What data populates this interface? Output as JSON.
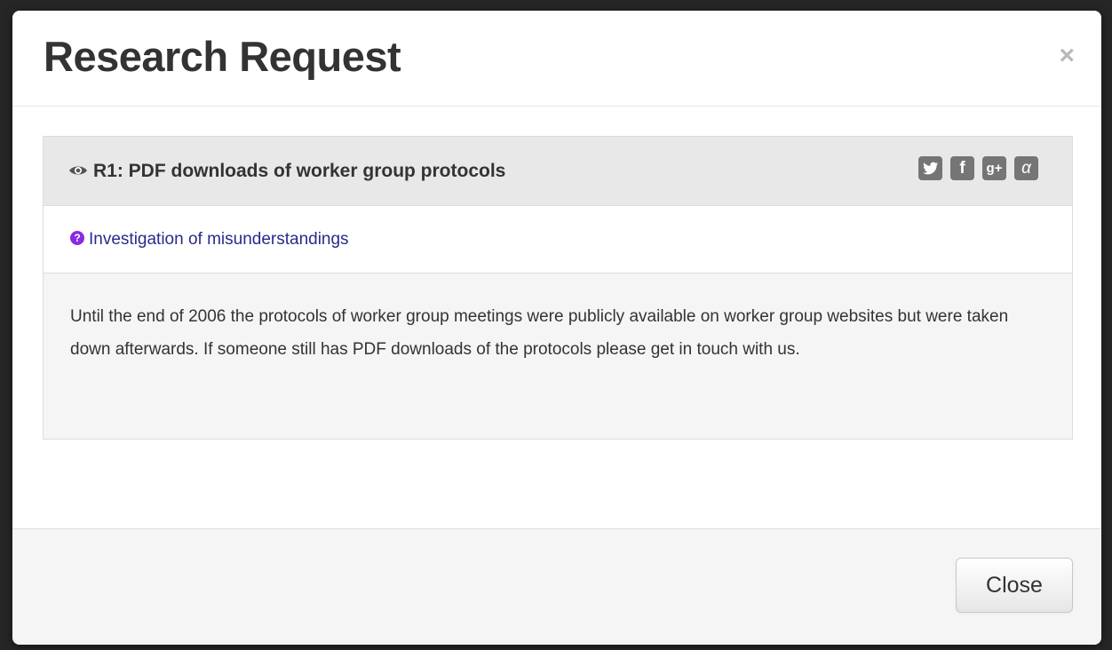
{
  "modal": {
    "title": "Research Request",
    "close_icon": "×",
    "close_button_label": "Close"
  },
  "request": {
    "title": "R1: PDF downloads of worker group protocols",
    "title_icon": "eye-icon",
    "category": "Investigation of misunderstandings",
    "category_icon": "question-circle-icon",
    "description": "Until the end of 2006 the protocols of worker group meetings were publicly available on worker group websites but were taken down afterwards. If someone still has PDF downloads of the protocols please get in touch with us."
  },
  "share": {
    "twitter_glyph": "t",
    "facebook_glyph": "f",
    "googleplus_glyph": "g+",
    "email_glyph": "α"
  },
  "colors": {
    "category_link": "#2a2a8c",
    "question_icon": "#8a2be2",
    "share_icon_bg": "#757575"
  }
}
